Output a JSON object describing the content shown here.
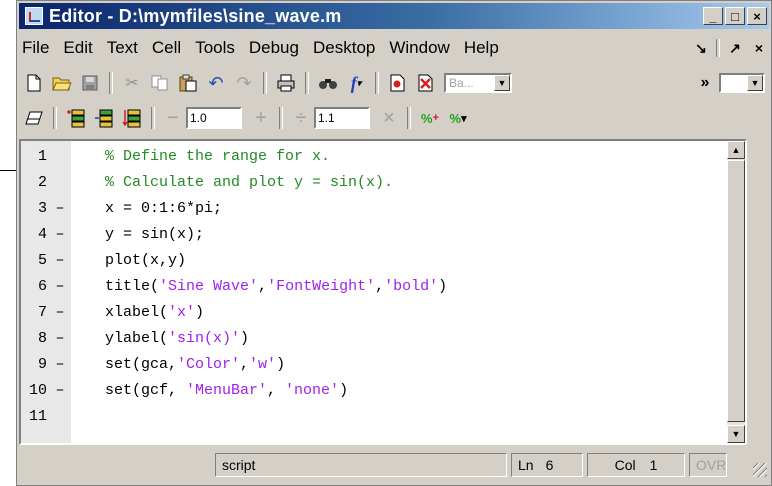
{
  "window": {
    "title": "Editor - D:\\mymfiles\\sine_wave.m",
    "controls": {
      "minimize": "_",
      "maximize": "□",
      "close": "×"
    }
  },
  "menu": {
    "items": [
      "File",
      "Edit",
      "Text",
      "Cell",
      "Tools",
      "Debug",
      "Desktop",
      "Window",
      "Help"
    ],
    "dock_glyph": "↘",
    "undock_glyph": "↗",
    "close_glyph": "×"
  },
  "toolbar": {
    "icons": [
      "new-file-icon",
      "open-folder-icon",
      "save-icon",
      "cut-icon",
      "copy-icon",
      "paste-icon",
      "undo-icon",
      "redo-icon",
      "print-icon",
      "find-icon",
      "function-icon",
      "set-breakpoint-icon",
      "clear-breakpoints-icon"
    ],
    "stack_combo": "Ba...",
    "overflow": "»"
  },
  "cell_toolbar": {
    "decrement_label": "−",
    "value_1": "1.0",
    "increment_label": "+",
    "divide_label": "÷",
    "value_2": "1.1",
    "multiply_label": "×"
  },
  "editor": {
    "lines": [
      {
        "num": "1",
        "marker": "",
        "code": "% Define the range for x."
      },
      {
        "num": "2",
        "marker": "",
        "code": "% Calculate and plot y = sin(x)."
      },
      {
        "num": "3",
        "marker": "–",
        "code": "x = 0:1:6*pi;"
      },
      {
        "num": "4",
        "marker": "–",
        "code": "y = sin(x);"
      },
      {
        "num": "5",
        "marker": "–",
        "code": "plot(x,y)"
      },
      {
        "num": "6",
        "marker": "–",
        "code": "title('Sine Wave','FontWeight','bold')"
      },
      {
        "num": "7",
        "marker": "–",
        "code": "xlabel('x')"
      },
      {
        "num": "8",
        "marker": "–",
        "code": "ylabel('sin(x)')"
      },
      {
        "num": "9",
        "marker": "–",
        "code": "set(gca,'Color','w')"
      },
      {
        "num": "10",
        "marker": "–",
        "code": "set(gcf, 'MenuBar', 'none')"
      },
      {
        "num": "11",
        "marker": "",
        "code": ""
      }
    ],
    "colors": {
      "comment": "#228b22",
      "string": "#a020f0",
      "code": "#000000"
    }
  },
  "status": {
    "mode": "script",
    "ln_label": "Ln",
    "ln": "6",
    "col_label": "Col",
    "col": "1",
    "ovr": "OVR"
  }
}
